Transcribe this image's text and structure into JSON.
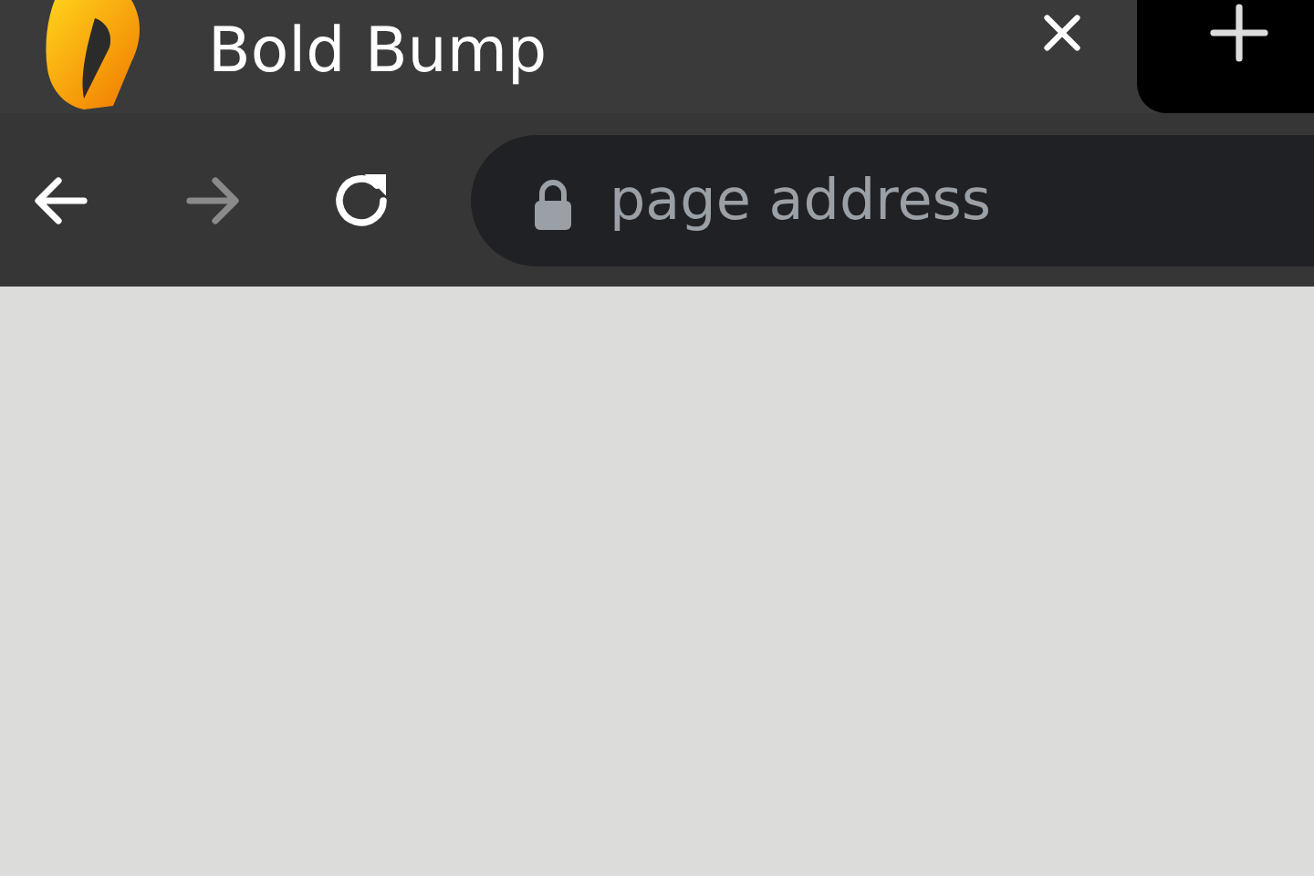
{
  "tab": {
    "title": "Bold Bump"
  },
  "nav_buttons": [
    {
      "kind": "back",
      "disabled": false
    },
    {
      "kind": "forward",
      "disabled": true
    },
    {
      "kind": "reload",
      "disabled": false
    }
  ],
  "address_bar": {
    "placeholder": "page address"
  }
}
